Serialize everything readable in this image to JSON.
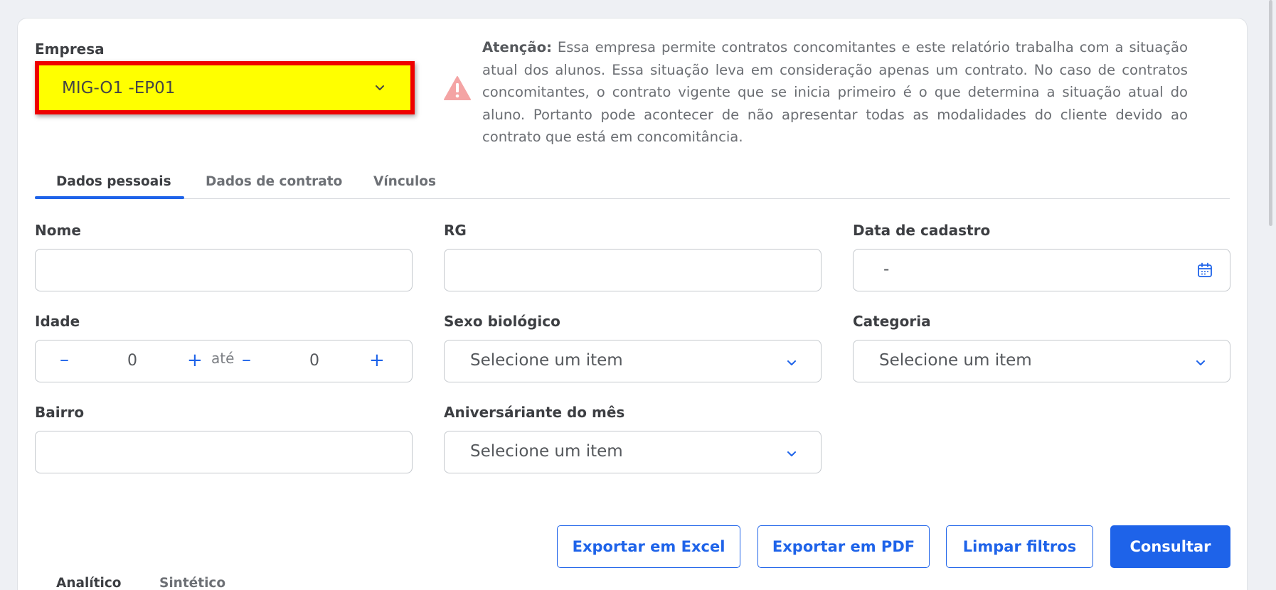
{
  "empresa": {
    "label": "Empresa",
    "value": "MIG-O1 -EP01"
  },
  "warning": {
    "bold": "Atenção:",
    "text": " Essa empresa permite contratos concomitantes e este relatório trabalha com a situação atual dos alunos. Essa situação leva em consideração apenas um contrato. No caso de contratos concomitantes, o contrato vigente que se inicia primeiro é o que determina a situação atual do aluno. Portanto pode acontecer de não apresentar todas as modalidades do cliente devido ao contrato que está em concomitância."
  },
  "tabs": [
    {
      "label": "Dados pessoais"
    },
    {
      "label": "Dados de contrato"
    },
    {
      "label": "Vínculos"
    }
  ],
  "fields": {
    "nome": {
      "label": "Nome",
      "value": ""
    },
    "rg": {
      "label": "RG",
      "value": ""
    },
    "data_cadastro": {
      "label": "Data de cadastro",
      "value": "-"
    },
    "idade": {
      "label": "Idade",
      "min": "0",
      "max": "0",
      "separator": "até",
      "minus": "–",
      "plus": "+"
    },
    "sexo": {
      "label": "Sexo biológico",
      "value": "Selecione um item"
    },
    "categoria": {
      "label": "Categoria",
      "value": "Selecione um item"
    },
    "bairro": {
      "label": "Bairro",
      "value": ""
    },
    "aniversariante": {
      "label": "Aniversáriante do mês",
      "value": "Selecione um item"
    }
  },
  "buttons": {
    "excel": "Exportar em Excel",
    "pdf": "Exportar em PDF",
    "limpar": "Limpar filtros",
    "consultar": "Consultar"
  },
  "result_tabs": [
    {
      "label": "Analítico"
    },
    {
      "label": "Sintético"
    }
  ],
  "colors": {
    "accent": "#1e63e9",
    "highlight": "#ffff00",
    "highlight_border": "#ee0000",
    "warning": "#f4a4a4"
  }
}
